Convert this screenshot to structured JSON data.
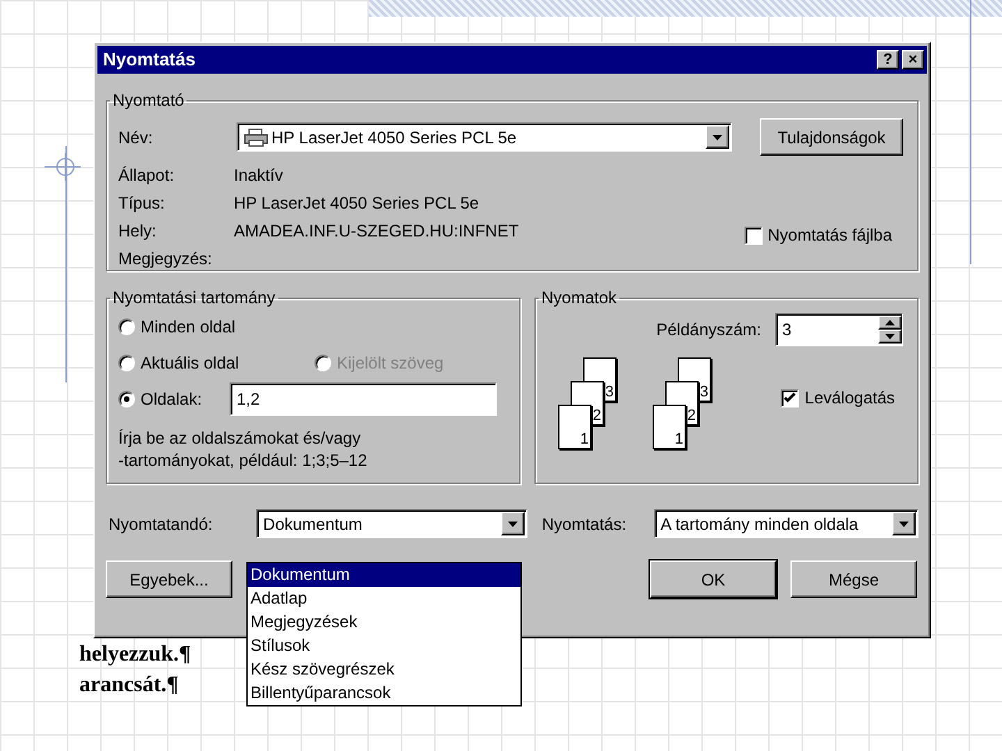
{
  "background_document": {
    "lines": [
      "helyezzuk.¶",
      "arancsát.¶"
    ]
  },
  "dialog": {
    "title": "Nyomtatás",
    "title_buttons": [
      "?",
      "×"
    ],
    "printer": {
      "group_title": "Nyomtató",
      "name_label": "Név:",
      "name_value": "HP LaserJet 4050 Series PCL 5e",
      "properties_button": "Tulajdonságok",
      "details": [
        {
          "label": "Állapot:",
          "value": "Inaktív"
        },
        {
          "label": "Típus:",
          "value": "HP LaserJet 4050 Series PCL 5e"
        },
        {
          "label": "Hely:",
          "value": "AMADEA.INF.U-SZEGED.HU:INFNET"
        },
        {
          "label": "Megjegyzés:"
        }
      ],
      "print_to_file": {
        "label": "Nyomtatás fájlba",
        "checked": false
      }
    },
    "page_range": {
      "group_title": "Nyomtatási tartomány",
      "rows": [
        [
          {
            "kind": "radio",
            "label": "Minden oldal",
            "selected": false,
            "disabled": false
          }
        ],
        [
          {
            "kind": "radio",
            "label": "Aktuális oldal",
            "selected": false,
            "disabled": false
          },
          {
            "kind": "radio",
            "label": "Kijelölt szöveg",
            "selected": false,
            "disabled": true
          }
        ],
        [
          {
            "kind": "pages",
            "label": "Oldalak:",
            "selected": true,
            "disabled": false,
            "value": "1,2"
          }
        ]
      ],
      "hint_lines": [
        "Írja be az oldalszámokat és/vagy",
        "-tartományokat, például: 1;3;5–12"
      ]
    },
    "copies": {
      "group_title": "Nyomatok",
      "count_label": "Példányszám:",
      "count_value": "3",
      "page_stacks": [
        [
          "3",
          "2",
          "1"
        ],
        [
          "3",
          "2",
          "1"
        ]
      ],
      "collate": {
        "label": "Leválogatás",
        "checked": true
      }
    },
    "print_what": {
      "label": "Nyomtatandó:",
      "value": "Dokumentum",
      "expanded": true,
      "options": [
        {
          "label": "Dokumentum",
          "selected": true
        },
        {
          "label": "Adatlap",
          "selected": false
        },
        {
          "label": "Megjegyzések",
          "selected": false
        },
        {
          "label": "Stílusok",
          "selected": false
        },
        {
          "label": "Kész szövegrészek",
          "selected": false
        },
        {
          "label": "Billentyűparancsok",
          "selected": false
        }
      ]
    },
    "print": {
      "label": "Nyomtatás:",
      "value": "A tartomány minden oldala"
    },
    "buttons": [
      {
        "label": "Egyebek...",
        "default": false
      },
      {
        "label": "OK",
        "default": true
      },
      {
        "label": "Mégse",
        "default": false
      }
    ]
  }
}
